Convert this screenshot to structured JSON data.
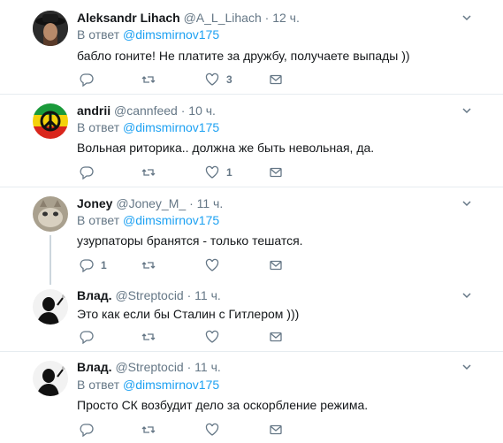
{
  "tweets": [
    {
      "name": "Aleksandr Lihach",
      "handle": "@A_L_Lihach",
      "dot": "·",
      "time": "12 ч.",
      "reply_prefix": "В ответ",
      "reply_to": "@dimsmirnov175",
      "text": "бабло гоните! Не платите за дружбу, получаете выпады ))",
      "replies": "",
      "retweets": "",
      "likes": "3"
    },
    {
      "name": "andrii",
      "handle": "@cannfeed",
      "dot": "·",
      "time": "10 ч.",
      "reply_prefix": "В ответ",
      "reply_to": "@dimsmirnov175",
      "text": "Вольная риторика.. должна же быть невольная, да.",
      "replies": "",
      "retweets": "",
      "likes": "1"
    },
    {
      "name": "Joney",
      "handle": "@Joney_M_",
      "dot": "·",
      "time": "11 ч.",
      "reply_prefix": "В ответ",
      "reply_to": "@dimsmirnov175",
      "text": "узурпаторы бранятся - только тешатся.",
      "replies": "1",
      "retweets": "",
      "likes": ""
    },
    {
      "name": "Влад.",
      "handle": "@Streptocid",
      "dot": "·",
      "time": "11 ч.",
      "text": "Это как если бы Сталин с Гитлером )))",
      "replies": "",
      "retweets": "",
      "likes": ""
    },
    {
      "name": "Влад.",
      "handle": "@Streptocid",
      "dot": "·",
      "time": "11 ч.",
      "reply_prefix": "В ответ",
      "reply_to": "@dimsmirnov175",
      "text": "Просто СК возбудит дело за оскорбление режима.",
      "replies": "",
      "retweets": "",
      "likes": ""
    }
  ],
  "icons": {
    "reply": "reply-icon",
    "retweet": "retweet-icon",
    "like": "heart-icon",
    "dm": "envelope-icon",
    "caret": "chevron-down-icon"
  },
  "colors": {
    "icon_gray": "#657786",
    "link_blue": "#1da1f2",
    "separator": "#e6ecf0"
  }
}
